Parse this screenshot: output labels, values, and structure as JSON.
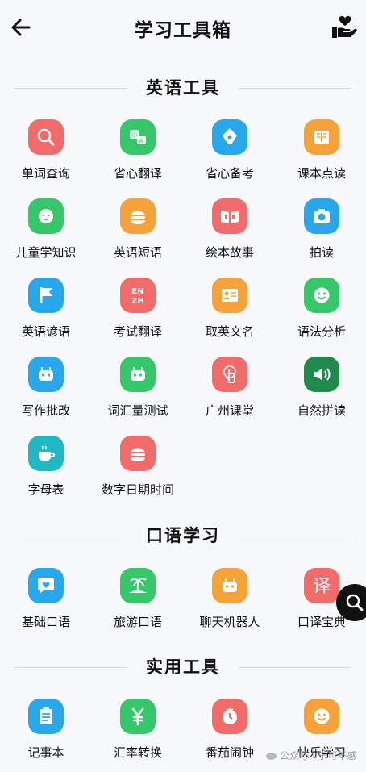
{
  "header": {
    "title": "学习工具箱",
    "back_icon": "arrow-left-icon",
    "right_icon": "heart-in-hand-icon"
  },
  "sections": [
    {
      "title": "英语工具",
      "items": [
        {
          "label": "单词查询",
          "icon": "search-icon",
          "color": "#f26b6b"
        },
        {
          "label": "省心翻译",
          "icon": "translate-icon",
          "color": "#35c76a"
        },
        {
          "label": "省心备考",
          "icon": "pen-nib-icon",
          "color": "#28a8ea"
        },
        {
          "label": "课本点读",
          "icon": "book-icon",
          "color": "#f5a23a"
        },
        {
          "label": "儿童学知识",
          "icon": "child-face-icon",
          "color": "#35c76a"
        },
        {
          "label": "英语短语",
          "icon": "burger-icon",
          "color": "#f5a23a"
        },
        {
          "label": "绘本故事",
          "icon": "open-book-icon",
          "color": "#f26b6b"
        },
        {
          "label": "拍读",
          "icon": "camera-icon",
          "color": "#28a8ea"
        },
        {
          "label": "英语谚语",
          "icon": "flag-icon",
          "color": "#28a8ea"
        },
        {
          "label": "考试翻译",
          "icon": "en-zh-icon",
          "color": "#f26b6b",
          "text": "EN\nZH"
        },
        {
          "label": "取英文名",
          "icon": "id-card-icon",
          "color": "#f5a23a"
        },
        {
          "label": "语法分析",
          "icon": "smile-icon",
          "color": "#35c76a"
        },
        {
          "label": "写作批改",
          "icon": "robot-icon",
          "color": "#28a8ea"
        },
        {
          "label": "词汇量测试",
          "icon": "robot-icon",
          "color": "#35c76a"
        },
        {
          "label": "广州课堂",
          "icon": "tap-icon",
          "color": "#f26b6b"
        },
        {
          "label": "自然拼读",
          "icon": "speaker-icon",
          "color": "#1f8a4c"
        },
        {
          "label": "字母表",
          "icon": "cup-icon",
          "color": "#1fb8c3"
        },
        {
          "label": "数字日期时间",
          "icon": "burger-icon",
          "color": "#f26b6b"
        }
      ]
    },
    {
      "title": "口语学习",
      "items": [
        {
          "label": "基础口语",
          "icon": "chat-heart-icon",
          "color": "#28a8ea"
        },
        {
          "label": "旅游口语",
          "icon": "palm-island-icon",
          "color": "#35c76a"
        },
        {
          "label": "聊天机器人",
          "icon": "robot-icon",
          "color": "#f5a23a"
        },
        {
          "label": "口译宝典",
          "icon": "yi-char-icon",
          "color": "#f26b6b",
          "text": "译"
        }
      ]
    },
    {
      "title": "实用工具",
      "items": [
        {
          "label": "记事本",
          "icon": "notepad-icon",
          "color": "#28a8ea"
        },
        {
          "label": "汇率转换",
          "icon": "yen-icon",
          "color": "#35c76a"
        },
        {
          "label": "番茄闹钟",
          "icon": "tomato-clock-icon",
          "color": "#f26b6b"
        },
        {
          "label": "快乐学习",
          "icon": "smile-icon",
          "color": "#f5a23a"
        }
      ]
    }
  ],
  "fab": {
    "icon": "search-icon"
  },
  "watermark": {
    "text": "公众号 · 宁可不感"
  }
}
